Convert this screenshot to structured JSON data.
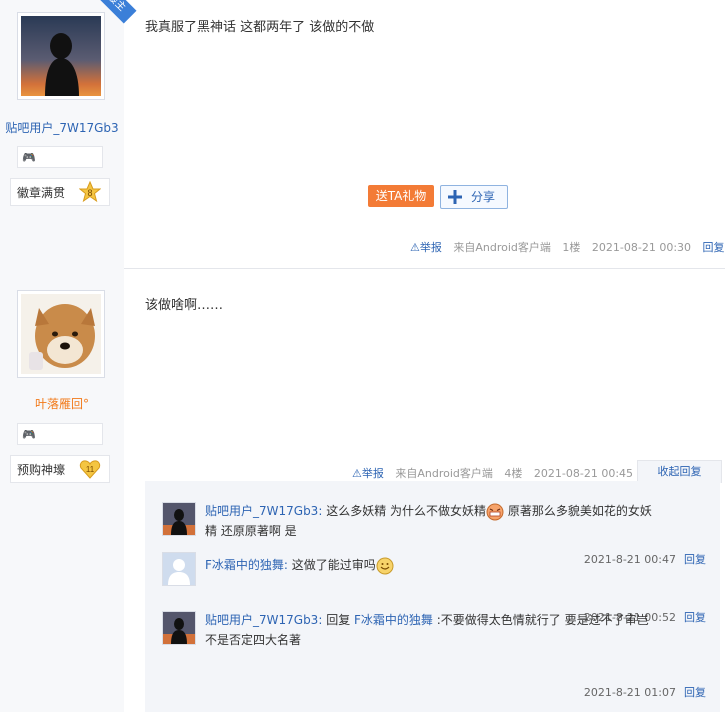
{
  "post1": {
    "author": "贴吧用户_7W17Gb3",
    "badge_title": "徽章满贯",
    "badge_level": "8",
    "corner_tag": "楼主",
    "content": "我真服了黑神话 这都两年了 该做的不做",
    "gift_button": "送TA礼物",
    "share_button": "分享",
    "report": "举报",
    "source": "来自Android客户端",
    "floor": "1楼",
    "time": "2021-08-21 00:30",
    "reply": "回复"
  },
  "post2": {
    "author": "叶落雁回°",
    "badge_title": "预购神壕",
    "badge_level": "11",
    "content": "该做啥啊……",
    "report": "举报",
    "source": "来自Android客户端",
    "floor": "4楼",
    "time": "2021-08-21 00:45",
    "collapse": "收起回复",
    "comments": [
      {
        "user": "贴吧用户_7W17Gb3:",
        "text_a": " 这么多妖精 为什么不做女妖精",
        "text_b": " 原著那么多貌美如花的女妖",
        "text_c": "精 还原原著啊 是",
        "time": "2021-8-21 00:47",
        "reply": "回复"
      },
      {
        "user": "F冰霜中的独舞:",
        "text_a": " 这做了能过审吗",
        "time": "2021-8-21 00:52",
        "reply": "回复"
      },
      {
        "user": "贴吧用户_7W17Gb3:",
        "reply_word": " 回复 ",
        "reply_to": "F冰霜中的独舞",
        "text_a": " :不要做得太色情就行了 要是过不了审岂",
        "text_b": "不是否定四大名著",
        "time": "2021-8-21 01:07",
        "reply": "回复"
      }
    ]
  },
  "colors": {
    "link": "#2d64b3",
    "gift": "#f37b36",
    "side_bg": "#f7f8fa",
    "lzl_bg": "#f3f5f9"
  }
}
